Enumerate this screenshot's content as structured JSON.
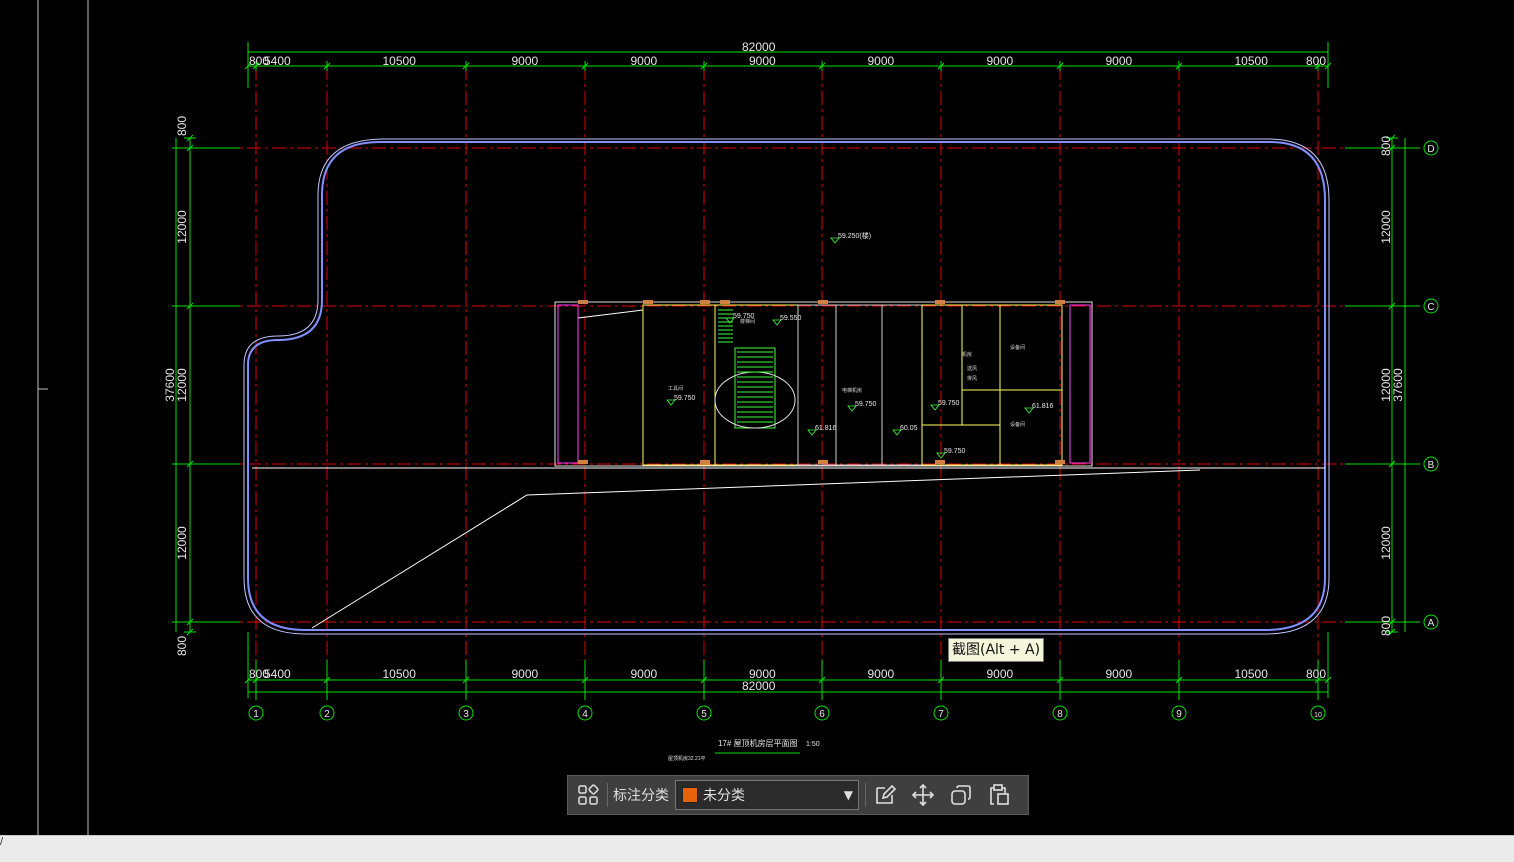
{
  "drawing": {
    "colors": {
      "background": "#000000",
      "axis": "#e00000",
      "dimension": "#00e000",
      "outline": "#8090ff",
      "core": "#ffff60",
      "text": "#e6e6e6"
    },
    "columns_total": "82000",
    "column_dims": [
      "800",
      "5400",
      "10500",
      "9000",
      "9000",
      "9000",
      "9000",
      "9000",
      "9000",
      "10500",
      "800"
    ],
    "column_labels": [
      "1",
      "2",
      "3",
      "4",
      "5",
      "6",
      "7",
      "8",
      "9",
      "10"
    ],
    "rows_total": "37600",
    "row_dims": [
      "800",
      "12000",
      "12000",
      "12000",
      "800"
    ],
    "row_labels": [
      "D",
      "C",
      "B",
      "A"
    ],
    "plan_title": "17# 屋顶机房层平面图",
    "plan_scale": "1:50",
    "plan_subtitle": "屋顶机房32.21平",
    "elevations": [
      "59.250(楼)",
      "59.550",
      "59.750",
      "59.750",
      "59.750",
      "59.750",
      "61.816",
      "61.816",
      "60.05",
      "59.750"
    ],
    "room_labels": [
      "工具间",
      "楼梯间",
      "电梯机房",
      "设备间",
      "设备间",
      "机房",
      "送风",
      "排风"
    ]
  },
  "tooltip": {
    "text": "截图(Alt + A)"
  },
  "toolbar": {
    "grid_icon": "grid-icon",
    "category_label": "标注分类",
    "category_value": "未分类",
    "category_color": "#e8620a",
    "icons": [
      "edit-icon",
      "move-icon",
      "copy-icon",
      "paste-icon"
    ]
  },
  "status": {
    "mark": "/"
  }
}
